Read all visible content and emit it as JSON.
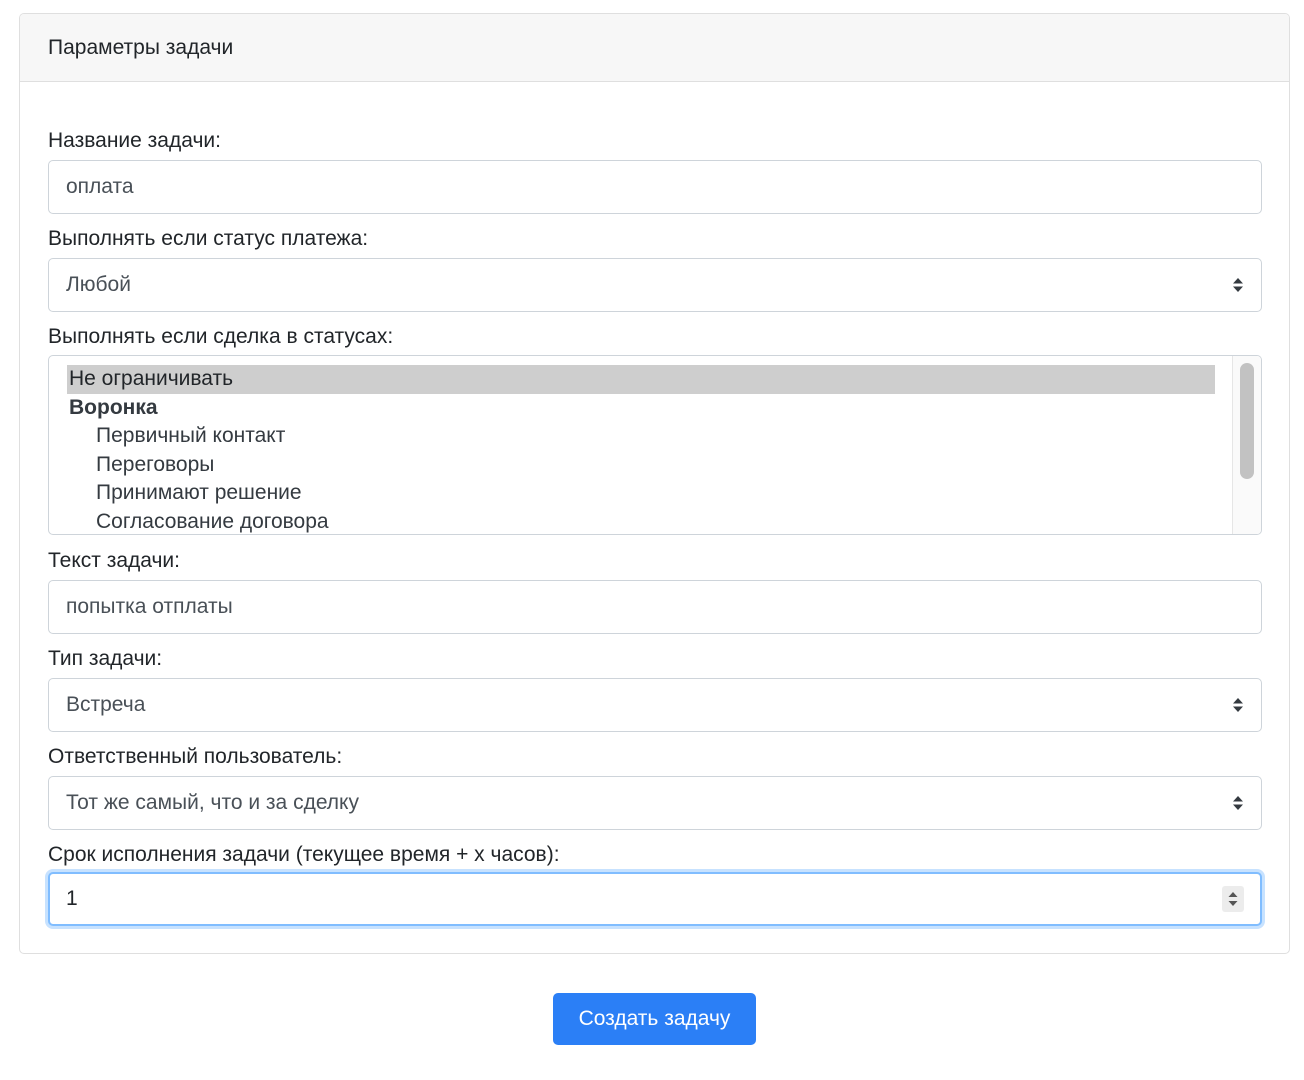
{
  "card": {
    "title": "Параметры задачи"
  },
  "fields": {
    "task_name": {
      "label": "Название задачи:",
      "value": "оплата"
    },
    "payment_status": {
      "label": "Выполнять если статус платежа:",
      "value": "Любой"
    },
    "deal_statuses": {
      "label": "Выполнять если сделка в статусах:",
      "options": [
        {
          "label": "Не ограничивать",
          "selected": true
        },
        {
          "label": "Воронка",
          "group": true
        },
        {
          "label": "Первичный контакт",
          "indent": true
        },
        {
          "label": "Переговоры",
          "indent": true
        },
        {
          "label": "Принимают решение",
          "indent": true
        },
        {
          "label": "Согласование договора",
          "indent": true
        }
      ]
    },
    "task_text": {
      "label": "Текст задачи:",
      "value": "попытка отплаты"
    },
    "task_type": {
      "label": "Тип задачи:",
      "value": "Встреча"
    },
    "responsible_user": {
      "label": "Ответственный пользователь:",
      "value": "Тот же самый, что и за сделку"
    },
    "due_hours": {
      "label": "Срок исполнения задачи (текущее время + х часов):",
      "value": "1"
    }
  },
  "submit": {
    "label": "Создать задачу"
  },
  "colors": {
    "primary": "#2b7ff6",
    "focus_border": "#80bdff",
    "header_bg": "#f7f7f7",
    "selected_option_bg": "#cecece"
  },
  "icons": {
    "select_arrows": "updown-arrows-icon",
    "number_spinner": "spinner-arrows-icon"
  }
}
